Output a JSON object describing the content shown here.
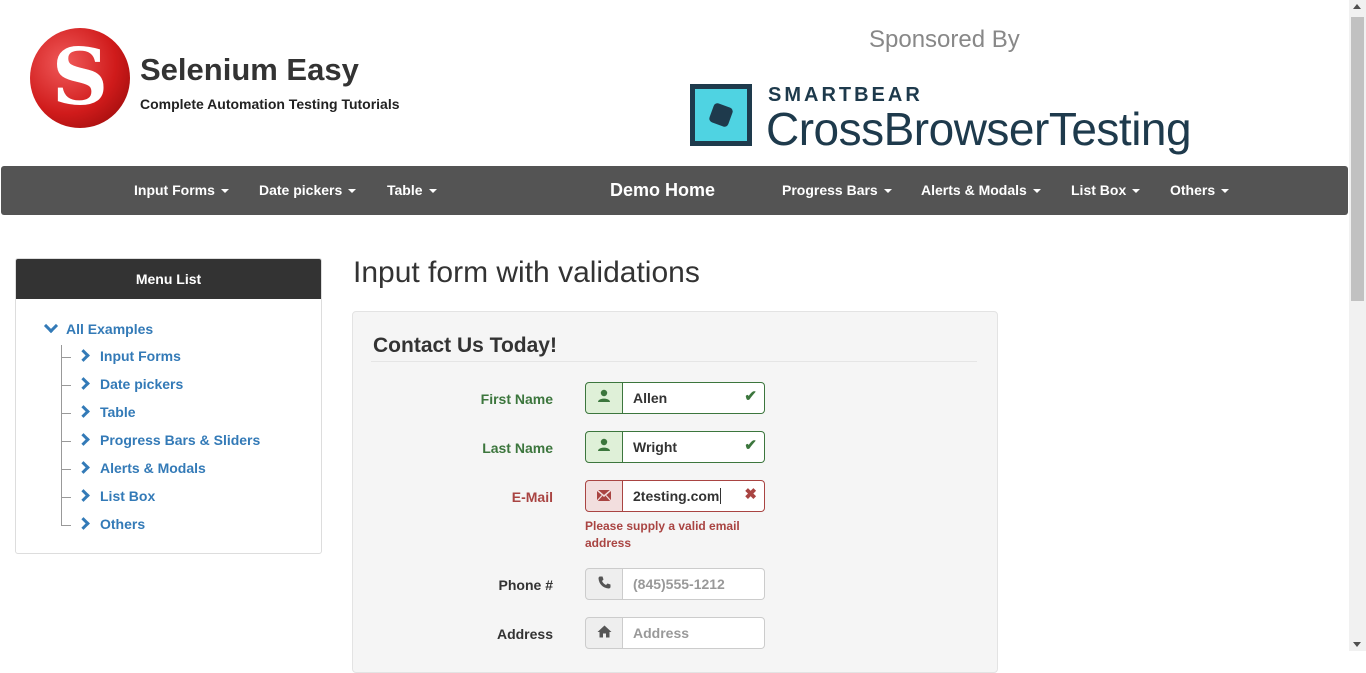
{
  "brand": {
    "title": "Selenium Easy",
    "subtitle": "Complete Automation Testing Tutorials",
    "logo_letter": "S"
  },
  "sponsor": {
    "label": "Sponsored By",
    "company": "SMARTBEAR",
    "product": "CrossBrowserTesting"
  },
  "navbar": {
    "left_items": [
      "Input Forms",
      "Date pickers",
      "Table"
    ],
    "home": "Demo Home",
    "right_items": [
      "Progress Bars",
      "Alerts & Modals",
      "List Box",
      "Others"
    ]
  },
  "sidebar": {
    "heading": "Menu List",
    "root": "All Examples",
    "items": [
      "Input Forms",
      "Date pickers",
      "Table",
      "Progress Bars & Sliders",
      "Alerts & Modals",
      "List Box",
      "Others"
    ]
  },
  "main": {
    "title": "Input form with validations",
    "legend": "Contact Us Today!",
    "fields": [
      {
        "label": "First Name",
        "value": "Allen",
        "state": "success",
        "icon": "user-icon"
      },
      {
        "label": "Last Name",
        "value": "Wright",
        "state": "success",
        "icon": "user-icon"
      },
      {
        "label": "E-Mail",
        "value": "2testing.com",
        "state": "error",
        "icon": "envelope-icon",
        "help": "Please supply a valid email address"
      },
      {
        "label": "Phone #",
        "placeholder": "(845)555-1212",
        "state": "neutral",
        "icon": "phone-icon"
      },
      {
        "label": "Address",
        "placeholder": "Address",
        "state": "neutral",
        "icon": "home-icon"
      }
    ]
  },
  "colors": {
    "navbar": "#545454",
    "success": "#3c763d",
    "error": "#a94442",
    "link": "#337ab7"
  }
}
